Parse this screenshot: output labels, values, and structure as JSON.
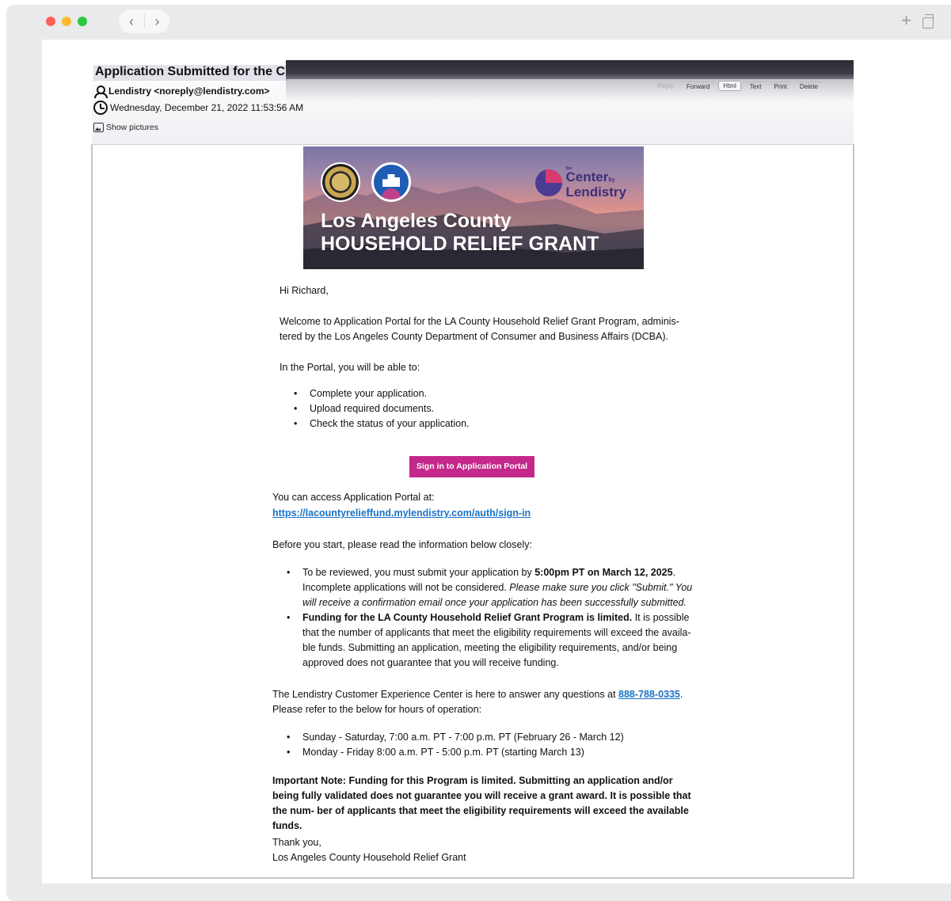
{
  "mail": {
    "subject": "Application Submitted for the C",
    "from": "Lendistry <noreply@lendistry.com>",
    "date": "Wednesday, December 21, 2022 11:53:56 AM",
    "show_pictures": "Show pictures",
    "actions": {
      "reply": "Reply",
      "forward": "Forward",
      "html": "Html",
      "text": "Text",
      "print": "Print",
      "delete": "Delete"
    }
  },
  "banner": {
    "line1": "Los Angeles County",
    "line2": "HOUSEHOLD RELIEF GRANT",
    "logo_the": "the",
    "logo_center": "Center",
    "logo_by": "by",
    "logo_lendistry": "Lendistry"
  },
  "body": {
    "greeting": "Hi Richard,",
    "welcome": "Welcome to Application Portal for the LA County Household Relief Grant Program, adminis- tered by the Los Angeles County Department of Consumer and Business Affairs (DCBA).",
    "portal_intro": "In the Portal, you will be able to:",
    "portal_items": [
      "Complete your application.",
      "Upload required documents.",
      "Check the status of your application."
    ],
    "cta": "Sign in to Application Portal",
    "access_text": "You can access Application Portal at:",
    "access_url": "https://lacountyrelieffund.mylendistry.com/auth/sign-in",
    "before_start": "Before you start, please read the information below closely:",
    "info1_a": "To be reviewed, you must submit your application by ",
    "info1_deadline": "5:00pm PT on March 12, 2025",
    "info1_b": ". Incomplete applications will not be considered. ",
    "info1_italic": "Please make sure you click \"Submit.\" You will receive a confirmation email once your application has been successfully submitted.",
    "info2_bold": "Funding for the LA County Household Relief Grant Program is limited.",
    "info2_rest": " It is possible that the number of applicants that meet the eligibility requirements will exceed the availa- ble funds. Submitting an application, meeting the eligibility requirements, and/or being approved does not guarantee that you will receive funding.",
    "support_a": "The Lendistry Customer Experience Center is here to answer any questions at ",
    "support_phone": "888-788-0335",
    "support_b": ". Please refer to the below for hours of operation:",
    "hours": [
      "Sunday - Saturday, 7:00 a.m. PT - 7:00 p.m. PT (February 26 - March 12)",
      "Monday - Friday 8:00 a.m. PT - 5:00 p.m. PT (starting March 13)"
    ],
    "important": "Important Note: Funding for this Program is limited. Submitting an application and/or being fully validated does not guarantee you will receive a grant award. It is possible that the num- ber of applicants that meet the eligibility requirements will exceed the available funds.",
    "signoff": "Thank you,",
    "signature": "Los Angeles County Household Relief Grant"
  },
  "colors": {
    "cta": "#c4288a",
    "link": "#1a73c7",
    "close": "#ff5f57",
    "minimize": "#febc2e",
    "maximize": "#28c840"
  },
  "icons": [
    "close-dot",
    "minimize-dot",
    "maximize-dot",
    "chevron-left-icon",
    "chevron-right-icon",
    "plus-icon",
    "restore-icon",
    "person-icon",
    "clock-icon",
    "picture-icon"
  ]
}
